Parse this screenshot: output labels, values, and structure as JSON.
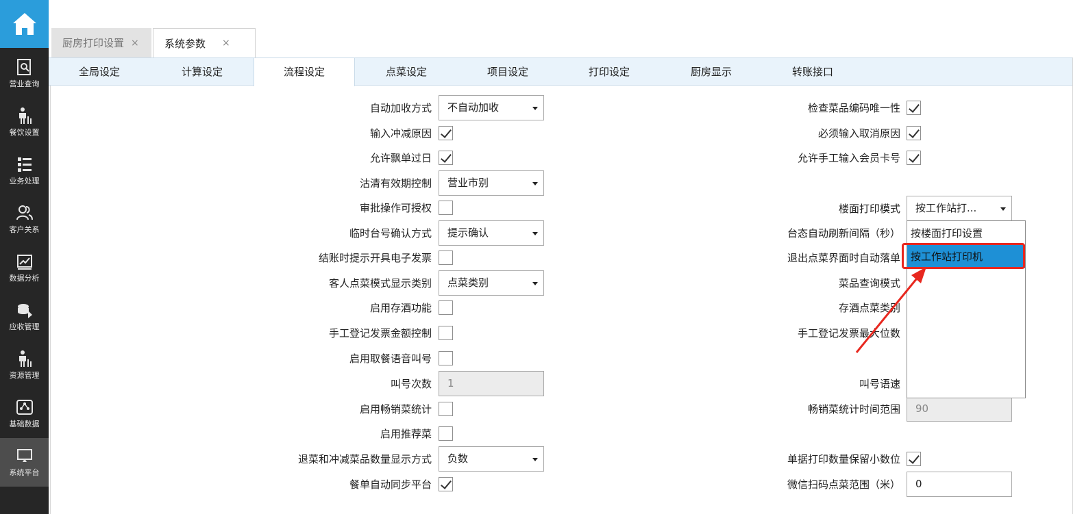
{
  "sidebar": {
    "home_icon": "home-icon",
    "items": [
      {
        "label": "营业查询",
        "icon": "report-search-icon"
      },
      {
        "label": "餐饮设置",
        "icon": "waiter-icon"
      },
      {
        "label": "业务处理",
        "icon": "list-icon"
      },
      {
        "label": "客户关系",
        "icon": "users-icon"
      },
      {
        "label": "数据分析",
        "icon": "chart-icon"
      },
      {
        "label": "应收管理",
        "icon": "coins-icon"
      },
      {
        "label": "资源管理",
        "icon": "waiter-icon"
      },
      {
        "label": "基础数据",
        "icon": "database-icon"
      },
      {
        "label": "系统平台",
        "icon": "monitor-icon"
      }
    ]
  },
  "tabs": [
    {
      "label": "厨房打印设置",
      "close": "×"
    },
    {
      "label": "系统参数",
      "close": "×"
    }
  ],
  "subtabs": [
    "全局设定",
    "计算设定",
    "流程设定",
    "点菜设定",
    "项目设定",
    "打印设定",
    "厨房显示",
    "转账接口"
  ],
  "left_fields": {
    "auto_surcharge": {
      "label": "自动加收方式",
      "value": "不自动加收"
    },
    "reduce_reason": {
      "label": "输入冲减原因",
      "checked": true
    },
    "allow_float": {
      "label": "允许飘单过日",
      "checked": true
    },
    "sellout_ctrl": {
      "label": "沽清有效期控制",
      "value": "营业市别"
    },
    "approval_auth": {
      "label": "审批操作可授权",
      "checked": false
    },
    "temp_table": {
      "label": "临时台号确认方式",
      "value": "提示确认"
    },
    "e_invoice": {
      "label": "结账时提示开具电子发票",
      "checked": false
    },
    "guest_order_mode": {
      "label": "客人点菜模式显示类别",
      "value": "点菜类别"
    },
    "wine_storage": {
      "label": "启用存酒功能",
      "checked": false
    },
    "manual_invoice": {
      "label": "手工登记发票金额控制",
      "checked": false
    },
    "voice_call": {
      "label": "启用取餐语音叫号",
      "checked": false
    },
    "call_times": {
      "label": "叫号次数",
      "value": "1"
    },
    "bestseller": {
      "label": "启用畅销菜统计",
      "checked": false
    },
    "recommend": {
      "label": "启用推荐菜",
      "checked": false
    },
    "return_display": {
      "label": "退菜和冲减菜品数量显示方式",
      "value": "负数"
    },
    "sync_platform": {
      "label": "餐单自动同步平台",
      "checked": true
    }
  },
  "right_fields": {
    "unique_code": {
      "label": "检查菜品编码唯一性",
      "checked": true
    },
    "cancel_reason": {
      "label": "必须输入取消原因",
      "checked": true
    },
    "manual_card": {
      "label": "允许手工输入会员卡号",
      "checked": true
    },
    "floor_print": {
      "label": "楼面打印模式",
      "value": "按工作站打..."
    },
    "refresh_interval": {
      "label": "台态自动刷新间隔（秒）"
    },
    "auto_drop": {
      "label": "退出点菜界面时自动落单"
    },
    "dish_query": {
      "label": "菜品查询模式"
    },
    "wine_category": {
      "label": "存酒点菜类别"
    },
    "invoice_digits": {
      "label": "手工登记发票最大位数"
    },
    "call_speed": {
      "label": "叫号语速"
    },
    "bestseller_range": {
      "label": "畅销菜统计时间范围",
      "value": "90"
    },
    "print_decimals": {
      "label": "单据打印数量保留小数位",
      "checked": true
    },
    "wechat_range": {
      "label": "微信扫码点菜范围（米）",
      "value": "0"
    }
  },
  "dropdown": {
    "options": [
      "按楼面打印设置",
      "按工作站打印机"
    ],
    "highlight_color": "#e8281f",
    "selected_color": "#1e90d6"
  },
  "colors": {
    "sidebar": "#262626",
    "home": "#2b9ddb",
    "subtab_bar": "#e9f3fb"
  }
}
